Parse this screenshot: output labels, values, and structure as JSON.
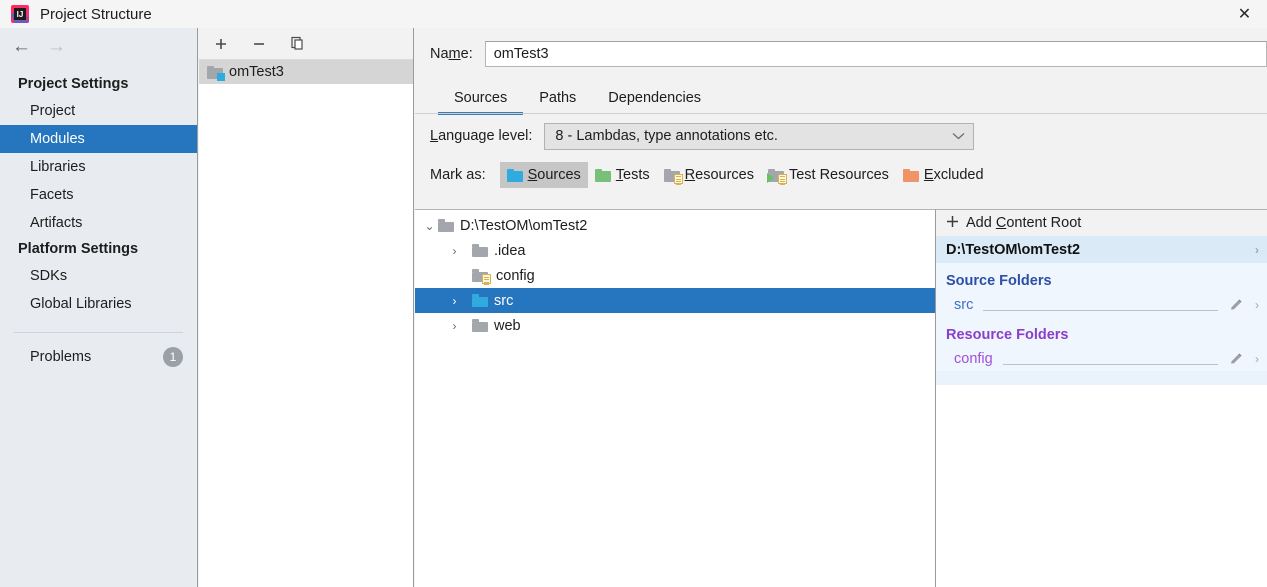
{
  "window": {
    "title": "Project Structure",
    "app_icon": "intellij-idea-icon",
    "close_label": "✕"
  },
  "sidebar": {
    "back_arrow": "←",
    "forward_arrow": "→",
    "groups": [
      {
        "label": "Project Settings",
        "items": [
          {
            "label": "Project",
            "selected": false
          },
          {
            "label": "Modules",
            "selected": true
          },
          {
            "label": "Libraries",
            "selected": false
          },
          {
            "label": "Facets",
            "selected": false
          },
          {
            "label": "Artifacts",
            "selected": false
          }
        ]
      },
      {
        "label": "Platform Settings",
        "items": [
          {
            "label": "SDKs",
            "selected": false
          },
          {
            "label": "Global Libraries",
            "selected": false
          }
        ]
      }
    ],
    "problems": {
      "label": "Problems",
      "count": "1"
    }
  },
  "modules_panel": {
    "toolbar": {
      "add": "+",
      "remove": "−",
      "copy": "copy-icon"
    },
    "items": [
      {
        "label": "omTest3",
        "icon": "module-folder-icon",
        "selected": true
      }
    ]
  },
  "main": {
    "name_field": {
      "label": "Name:",
      "value": "omTest3",
      "placeholder": ""
    },
    "tabs": [
      {
        "label": "Sources",
        "active": true
      },
      {
        "label": "Paths",
        "active": false
      },
      {
        "label": "Dependencies",
        "active": false
      }
    ],
    "language_level": {
      "label": "Language level:",
      "value": "8 - Lambdas, type annotations etc.",
      "chevron": "⌄"
    },
    "mark_as": {
      "label": "Mark as:",
      "options": [
        {
          "label": "Sources",
          "mnemonic": "S",
          "rest": "ources",
          "icon": "folder-blue-icon",
          "pressed": true
        },
        {
          "label": "Tests",
          "mnemonic": "T",
          "rest": "ests",
          "icon": "folder-green-icon",
          "pressed": false
        },
        {
          "label": "Resources",
          "mnemonic": "R",
          "rest": "esources",
          "icon": "folder-gray-resource-icon",
          "pressed": false
        },
        {
          "label": "Test Resources",
          "mnemonic": "",
          "rest": "Test Resources",
          "icon": "folder-test-resource-icon",
          "pressed": false
        },
        {
          "label": "Excluded",
          "mnemonic": "E",
          "rest": "xcluded",
          "icon": "folder-orange-icon",
          "pressed": false
        }
      ]
    },
    "tree": [
      {
        "label": "D:\\TestOM\\omTest2",
        "indent": 0,
        "twisty": "⌄",
        "icon": "folder-gray-icon",
        "selected": false
      },
      {
        "label": ".idea",
        "indent": 1,
        "twisty": "›",
        "icon": "folder-gray-icon",
        "selected": false
      },
      {
        "label": "config",
        "indent": 1,
        "twisty": "",
        "icon": "folder-gray-resource-icon",
        "selected": false
      },
      {
        "label": "src",
        "indent": 1,
        "twisty": "›",
        "icon": "folder-blue-icon",
        "selected": true
      },
      {
        "label": "web",
        "indent": 1,
        "twisty": "›",
        "icon": "folder-gray-icon",
        "selected": false
      }
    ],
    "right_pane": {
      "add_content_root": {
        "label_pre": "Add ",
        "mnemonic": "C",
        "label_post": "ontent Root",
        "icon": "plus-icon"
      },
      "content_root": {
        "path": "D:\\TestOM\\omTest2",
        "chevron": "›"
      },
      "sections": [
        {
          "title": "Source Folders",
          "kind": "source",
          "folders": [
            {
              "name": "src",
              "edit_icon": "pencil-icon",
              "chevron": "›"
            }
          ]
        },
        {
          "title": "Resource Folders",
          "kind": "resource",
          "folders": [
            {
              "name": "config",
              "edit_icon": "pencil-icon",
              "chevron": "›"
            }
          ]
        }
      ]
    }
  },
  "colors": {
    "accent_selection": "#2675bf",
    "tab_underline": "#3d7ab8",
    "source_blue": "#2c4fa8",
    "resource_purple": "#8a3ecb",
    "sidebar_bg": "#e8ecf0",
    "right_pane_bg": "#f0f6fd"
  }
}
